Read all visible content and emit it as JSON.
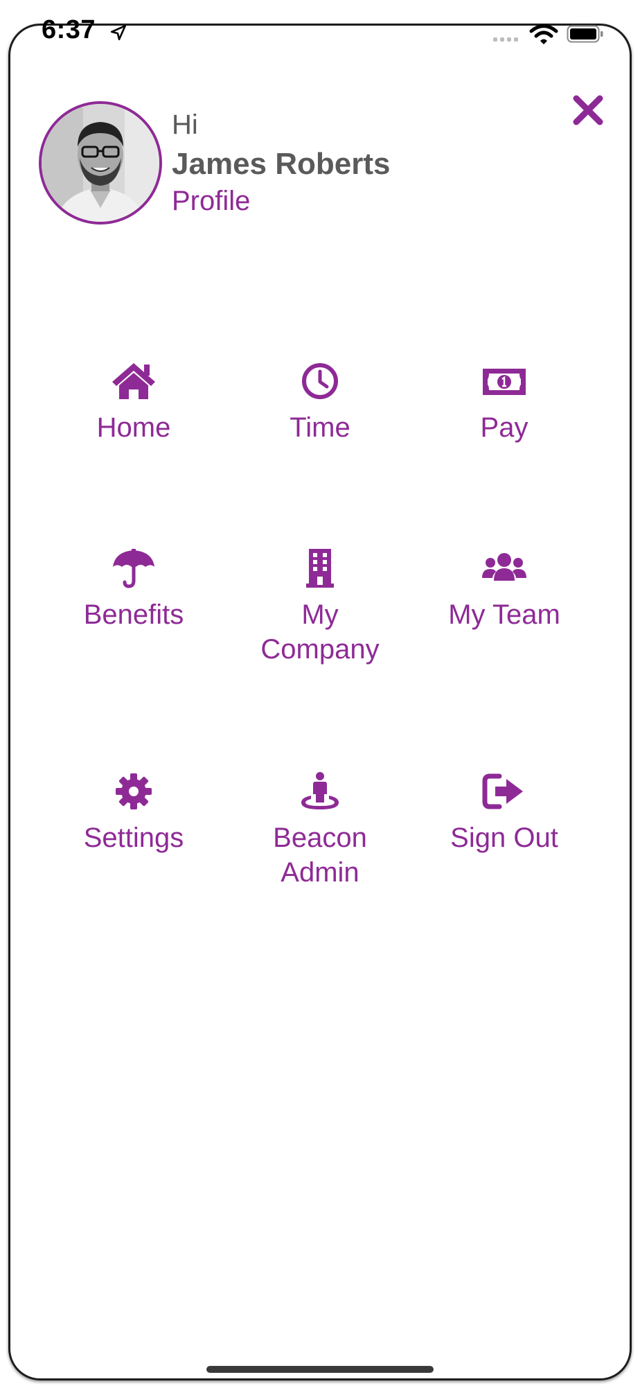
{
  "status_bar": {
    "time": "6:37",
    "icons": [
      "location-arrow-icon",
      "cellular-signal-icon",
      "wifi-icon",
      "battery-icon"
    ]
  },
  "header": {
    "greeting": "Hi",
    "user_name": "James Roberts",
    "profile_label": "Profile",
    "avatar": "user-avatar-photo",
    "close_icon": "close-icon"
  },
  "menu": {
    "items": [
      {
        "label": "Home",
        "icon": "home-icon"
      },
      {
        "label": "Time",
        "icon": "clock-icon"
      },
      {
        "label": "Pay",
        "icon": "money-bill-icon"
      },
      {
        "label": "Benefits",
        "icon": "umbrella-icon"
      },
      {
        "label": "My Company",
        "icon": "building-icon"
      },
      {
        "label": "My Team",
        "icon": "users-icon"
      },
      {
        "label": "Settings",
        "icon": "gear-icon"
      },
      {
        "label": "Beacon Admin",
        "icon": "street-view-icon"
      },
      {
        "label": "Sign Out",
        "icon": "sign-out-icon"
      }
    ]
  },
  "colors": {
    "accent": "#8e2a96",
    "text": "#5a5a5a",
    "background": "#ffffff"
  }
}
